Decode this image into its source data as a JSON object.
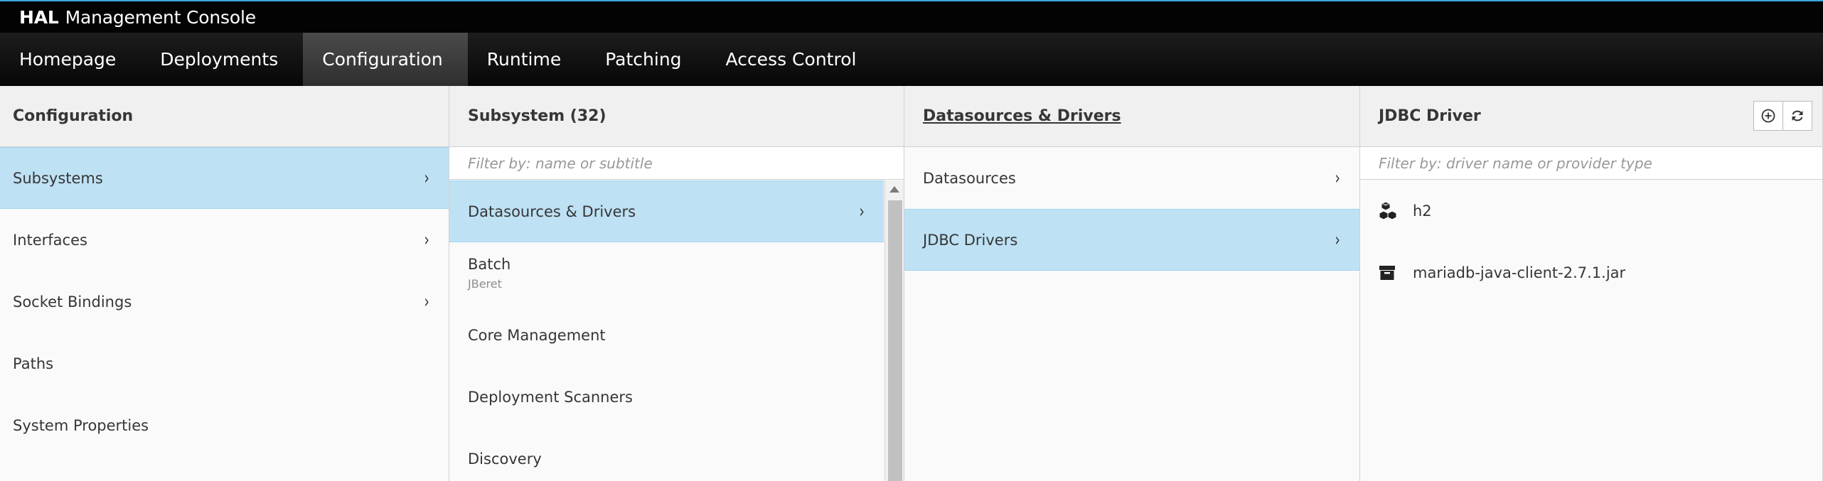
{
  "app": {
    "brand_strong": "HAL",
    "brand_light": "Management Console"
  },
  "nav": {
    "items": [
      {
        "label": "Homepage",
        "active": false
      },
      {
        "label": "Deployments",
        "active": false
      },
      {
        "label": "Configuration",
        "active": true
      },
      {
        "label": "Runtime",
        "active": false
      },
      {
        "label": "Patching",
        "active": false
      },
      {
        "label": "Access Control",
        "active": false
      }
    ]
  },
  "configuration": {
    "title": "Configuration",
    "items": [
      {
        "label": "Subsystems",
        "selected": true,
        "has_chevron": true
      },
      {
        "label": "Interfaces",
        "selected": false,
        "has_chevron": true
      },
      {
        "label": "Socket Bindings",
        "selected": false,
        "has_chevron": true
      },
      {
        "label": "Paths",
        "selected": false,
        "has_chevron": false
      },
      {
        "label": "System Properties",
        "selected": false,
        "has_chevron": false
      }
    ]
  },
  "subsystem": {
    "title": "Subsystem (32)",
    "filter_placeholder": "Filter by: name or subtitle",
    "items": [
      {
        "label": "Datasources & Drivers",
        "subtitle": "",
        "selected": true,
        "has_chevron": true
      },
      {
        "label": "Batch",
        "subtitle": "JBeret",
        "selected": false,
        "has_chevron": false
      },
      {
        "label": "Core Management",
        "subtitle": "",
        "selected": false,
        "has_chevron": false
      },
      {
        "label": "Deployment Scanners",
        "subtitle": "",
        "selected": false,
        "has_chevron": false
      },
      {
        "label": "Discovery",
        "subtitle": "",
        "selected": false,
        "has_chevron": false
      }
    ]
  },
  "datasources": {
    "title": "Datasources & Drivers",
    "items": [
      {
        "label": "Datasources",
        "selected": false,
        "has_chevron": true
      },
      {
        "label": "JDBC Drivers",
        "selected": true,
        "has_chevron": true
      }
    ]
  },
  "jdbc": {
    "title": "JDBC Driver",
    "filter_placeholder": "Filter by: driver name or provider type",
    "add_button_icon": "plus-circle-icon",
    "refresh_button_icon": "refresh-icon",
    "items": [
      {
        "label": "h2",
        "icon": "cubes-icon"
      },
      {
        "label": "mariadb-java-client-2.7.1.jar",
        "icon": "archive-icon"
      }
    ]
  },
  "colors": {
    "selected_bg": "#bee1f4",
    "header_bg": "#f0f0f0",
    "topbar_bg": "#030303",
    "accent": "#39a5dc"
  }
}
